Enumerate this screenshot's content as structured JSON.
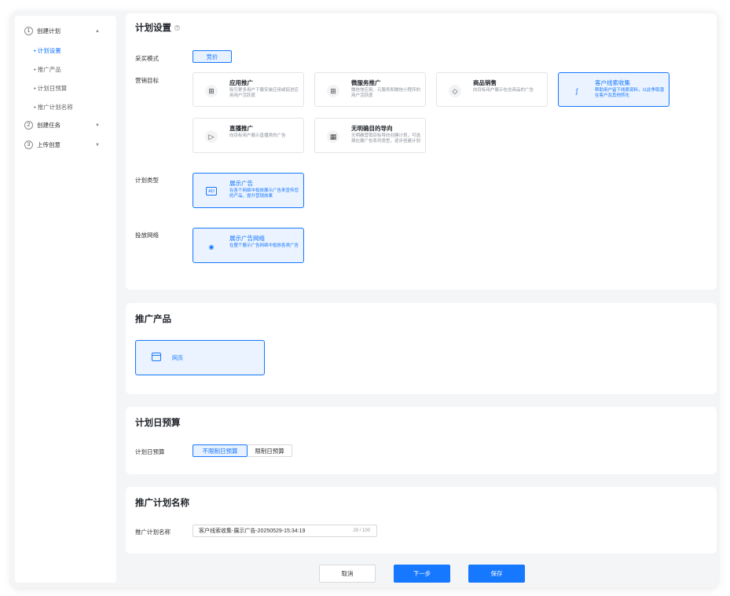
{
  "sidebar": {
    "steps": [
      {
        "num": "1",
        "label": "创建计划",
        "caret": "▲"
      },
      {
        "num": "2",
        "label": "创建任务",
        "caret": "▼"
      },
      {
        "num": "3",
        "label": "上传创意",
        "caret": "▼"
      }
    ],
    "subitems": [
      {
        "label": "• 计划设置"
      },
      {
        "label": "• 推广产品"
      },
      {
        "label": "• 计划日预算"
      },
      {
        "label": "• 推广计划名称"
      }
    ]
  },
  "plan": {
    "title": "计划设置",
    "help_icon": "?",
    "buy_mode_label": "采买模式",
    "buy_mode_value": "竞价",
    "goal_label": "营销目标",
    "goals": [
      {
        "title": "应用推广",
        "desc": "吸引更多用户下载安装应用或促进应用用户活跃度",
        "icon": "apps-icon"
      },
      {
        "title": "微服务推广",
        "desc": "微信快应用、元服务和微信小程序的用户活跃度",
        "icon": "grid-plus-icon"
      },
      {
        "title": "商品销售",
        "desc": "向目标用户展示包含商品的广告",
        "icon": "tag-icon"
      },
      {
        "title": "客户线索收集",
        "desc": "帮助用户留下线索资料，以此争取潜在客户及其他转化",
        "icon": "lead-icon"
      },
      {
        "title": "直播推广",
        "desc": "向目标用户展示直播类的广告",
        "icon": "live-icon"
      },
      {
        "title": "无明确目的导向",
        "desc": "无明确营销目标导向创建计划，可选择在展广告系列类型，逐步创建计划",
        "icon": "box-icon"
      }
    ],
    "type_label": "计划类型",
    "type_option": {
      "title": "展示广告",
      "desc": "在各个网络中投放展示广告来宣传您的产品，提升营销效果",
      "badge": "AD"
    },
    "network_label": "投放网络",
    "network_option": {
      "title": "展示广告网络",
      "desc": "在整个展示广告网络中投放各类广告"
    }
  },
  "product": {
    "title": "推广产品",
    "option": "网页"
  },
  "budget": {
    "title": "计划日预算",
    "label": "计划日预算",
    "options": [
      "不限制日预算",
      "限制日预算"
    ]
  },
  "name": {
    "title": "推广计划名称",
    "label": "推广计划名称",
    "value": "客户线索收集-展示广告-20250529-15:34:19",
    "count": "29 / 100"
  },
  "footer": {
    "cancel": "取消",
    "next": "下一步",
    "save": "保存"
  },
  "colors": {
    "accent": "#1677ff",
    "selected_bg": "#eaf3ff"
  }
}
